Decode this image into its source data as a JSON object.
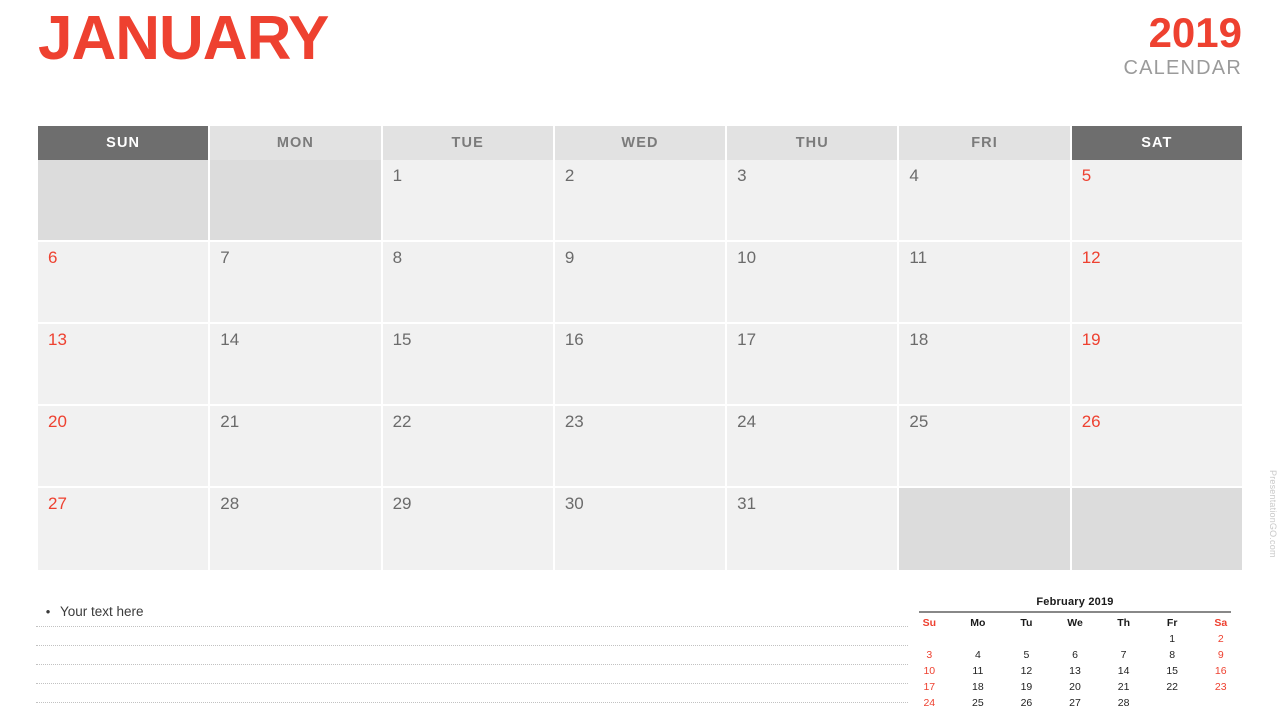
{
  "header": {
    "month": "JANUARY",
    "year": "2019",
    "subtitle": "CALENDAR"
  },
  "calendar": {
    "weekdays": [
      "SUN",
      "MON",
      "TUE",
      "WED",
      "THU",
      "FRI",
      "SAT"
    ],
    "weeks": [
      [
        {
          "day": "",
          "blank": true
        },
        {
          "day": "",
          "blank": true
        },
        {
          "day": "1"
        },
        {
          "day": "2"
        },
        {
          "day": "3"
        },
        {
          "day": "4"
        },
        {
          "day": "5"
        }
      ],
      [
        {
          "day": "6"
        },
        {
          "day": "7"
        },
        {
          "day": "8"
        },
        {
          "day": "9"
        },
        {
          "day": "10"
        },
        {
          "day": "11"
        },
        {
          "day": "12"
        }
      ],
      [
        {
          "day": "13"
        },
        {
          "day": "14"
        },
        {
          "day": "15"
        },
        {
          "day": "16"
        },
        {
          "day": "17"
        },
        {
          "day": "18"
        },
        {
          "day": "19"
        }
      ],
      [
        {
          "day": "20"
        },
        {
          "day": "21"
        },
        {
          "day": "22"
        },
        {
          "day": "23"
        },
        {
          "day": "24"
        },
        {
          "day": "25"
        },
        {
          "day": "26"
        }
      ],
      [
        {
          "day": "27"
        },
        {
          "day": "28"
        },
        {
          "day": "29"
        },
        {
          "day": "30"
        },
        {
          "day": "31"
        },
        {
          "day": "",
          "blank": true
        },
        {
          "day": "",
          "blank": true
        }
      ]
    ]
  },
  "notes": {
    "bullet": "•",
    "text": "Your text here",
    "line_count": 5
  },
  "mini_calendar": {
    "title": "February 2019",
    "weekdays": [
      "Su",
      "Mo",
      "Tu",
      "We",
      "Th",
      "Fr",
      "Sa"
    ],
    "weeks": [
      [
        "",
        "",
        "",
        "",
        "",
        "1",
        "2"
      ],
      [
        "3",
        "4",
        "5",
        "6",
        "7",
        "8",
        "9"
      ],
      [
        "10",
        "11",
        "12",
        "13",
        "14",
        "15",
        "16"
      ],
      [
        "17",
        "18",
        "19",
        "20",
        "21",
        "22",
        "23"
      ],
      [
        "24",
        "25",
        "26",
        "27",
        "28",
        "",
        ""
      ]
    ]
  },
  "watermark": "PresentationGO.com",
  "colors": {
    "accent_red": "#ee4130",
    "header_dark": "#6e6e6e",
    "header_light": "#e2e2e2",
    "cell_bg": "#f1f1f1",
    "blank_cell_bg": "#dcdcdc",
    "subtitle_gray": "#9b9b9b"
  }
}
